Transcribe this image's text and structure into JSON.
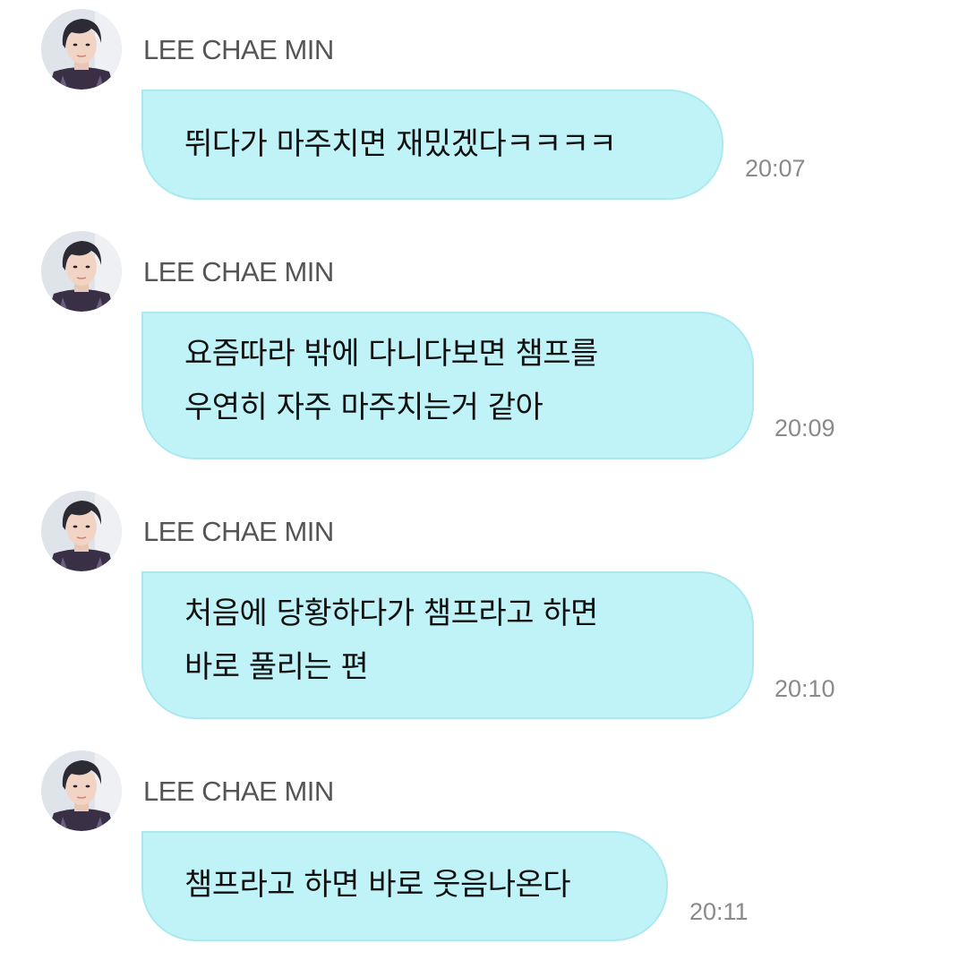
{
  "messages": [
    {
      "sender": "LEE CHAE MIN",
      "avatar_icon": "profile-photo",
      "lines": [
        "뛰다가 마주치면 재밌겠다ㅋㅋㅋㅋ"
      ],
      "time": "20:07"
    },
    {
      "sender": "LEE CHAE MIN",
      "avatar_icon": "profile-photo",
      "lines": [
        "요즘따라 밖에 다니다보면 챔프를",
        "우연히 자주 마주치는거 같아"
      ],
      "time": "20:09"
    },
    {
      "sender": "LEE CHAE MIN",
      "avatar_icon": "profile-photo",
      "lines": [
        "처음에 당황하다가 챔프라고 하면",
        "바로 풀리는 편"
      ],
      "time": "20:10"
    },
    {
      "sender": "LEE CHAE MIN",
      "avatar_icon": "profile-photo",
      "lines": [
        "챔프라고 하면 바로 웃음나온다"
      ],
      "time": "20:11"
    }
  ],
  "colors": {
    "bubble_fill": "#bff3f7",
    "bubble_border": "#abe9ef",
    "name_text": "#555555",
    "time_text": "#8a8a8a"
  }
}
